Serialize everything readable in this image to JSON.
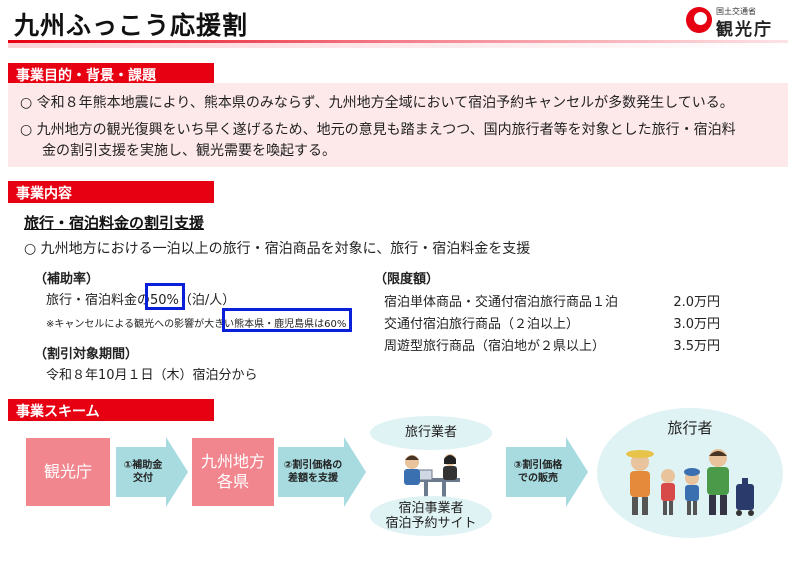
{
  "header": {
    "title": "九州ふっこう応援割",
    "logo_small": "国土交通省",
    "logo_main": "観光庁"
  },
  "section1": {
    "heading": "事業目的・背景・課題",
    "bullets": [
      "○ 令和８年熊本地震により、熊本県のみならず、九州地方全域において宿泊予約キャンセルが多数発生している。",
      "○ 九州地方の観光復興をいち早く遂げるため、地元の意見も踏まえつつ、国内旅行者等を対象とした旅行・宿泊料",
      "金の割引支援を実施し、観光需要を喚起する。"
    ]
  },
  "section2": {
    "heading": "事業内容",
    "subheading": "旅行・宿泊料金の割引支援",
    "bullet": "○ 九州地方における一泊以上の旅行・宿泊商品を対象に、旅行・宿泊料金を支援",
    "subsidy": {
      "label": "（補助率）",
      "line_prefix": "旅行・宿泊料金の",
      "rate": "50%",
      "line_suffix": "（泊/人）",
      "note_prefix": "※キャンセルによる観光への影響が大きい",
      "note_highlight": "熊本県・鹿児島県は60%"
    },
    "period": {
      "label": "（割引対象期間）",
      "value": "令和８年10月１日（木）宿泊分から"
    },
    "limit": {
      "label": "（限度額）",
      "rows": [
        {
          "name": "宿泊単体商品・交通付宿泊旅行商品１泊",
          "amount": "2.0万円"
        },
        {
          "name": "交通付宿泊旅行商品（２泊以上）",
          "amount": "3.0万円"
        },
        {
          "name": "周遊型旅行商品（宿泊地が２県以上）",
          "amount": "3.5万円"
        }
      ]
    }
  },
  "section3": {
    "heading": "事業スキーム",
    "box1": "観光庁",
    "arrow1": [
      "①補助金",
      "交付"
    ],
    "box2": [
      "九州地方",
      "各県"
    ],
    "arrow2": [
      "②割引価格の",
      "差額を支援"
    ],
    "oval_top": "旅行業者",
    "oval_bottom": [
      "宿泊事業者",
      "宿泊予約サイト"
    ],
    "arrow3": [
      "③割引価格",
      "での販売"
    ],
    "oval_right": "旅行者"
  },
  "colors": {
    "accent_red": "#e60012",
    "flow_pink": "#f2868f",
    "arrow_teal": "#a7dbe0",
    "highlight_blue": "#0a1fd8",
    "panel_pink": "#fde8ea",
    "oval_blue": "#dff2f4"
  }
}
